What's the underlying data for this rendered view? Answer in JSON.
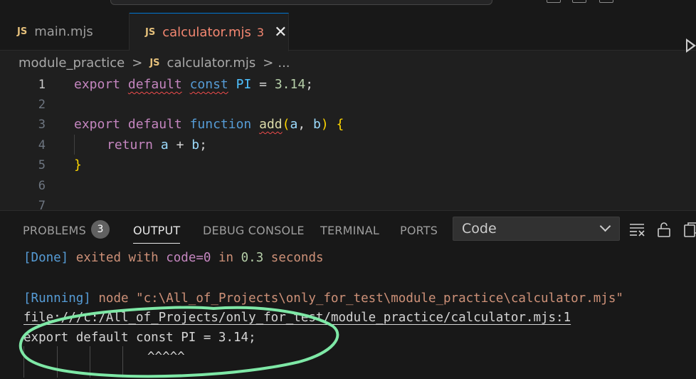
{
  "tabs": [
    {
      "file_badge": "JS",
      "label": "main.mjs"
    },
    {
      "file_badge": "JS",
      "label": "calculator.mjs",
      "problem_count": "3",
      "close_glyph": "✕"
    }
  ],
  "breadcrumb": {
    "folder": "module_practice",
    "separator": ">",
    "file_badge": "JS",
    "file": "calculator.mjs",
    "ellipsis": "..."
  },
  "editor": {
    "line_numbers": [
      "1",
      "2",
      "3",
      "4",
      "5",
      "6",
      "7"
    ],
    "line1": {
      "t1": "export",
      "t2": "default",
      "t3": "const",
      "t4": "PI",
      "t5": "=",
      "t6": "3.14",
      "t7": ";"
    },
    "line3": {
      "t1": "export",
      "t2": "default",
      "t3": "function",
      "t4": "add",
      "t5": "(",
      "t6": "a",
      "t7": ",",
      "t8": "b",
      "t9": ")",
      "t10": "{"
    },
    "line4": {
      "t1": "return",
      "t2": "a",
      "t3": "+",
      "t4": "b",
      "t5": ";"
    },
    "line5": {
      "t1": "}"
    }
  },
  "panel": {
    "tabs": {
      "problems": "PROBLEMS",
      "problems_count": "3",
      "output": "OUTPUT",
      "debug_console": "DEBUG CONSOLE",
      "terminal": "TERMINAL",
      "ports": "PORTS"
    },
    "channel_select": "Code",
    "output_lines": {
      "l1": {
        "a": "[Done]",
        "b": "exited",
        "c": "with",
        "d": "code=0",
        "e": "in",
        "f": "0.3",
        "g": "seconds"
      },
      "l2": {
        "a": "[Running]",
        "b": "node \"c:\\All_of_Projects\\only_for_test\\module_practice\\calculator.mjs\""
      },
      "l3": "file:///c:/All_of_Projects/only_for_test/module_practice/calculator.mjs:1",
      "l4": "export default const PI = 3.14;",
      "l5": "^^^^^"
    }
  },
  "annotation_color": "#7ee8a6"
}
